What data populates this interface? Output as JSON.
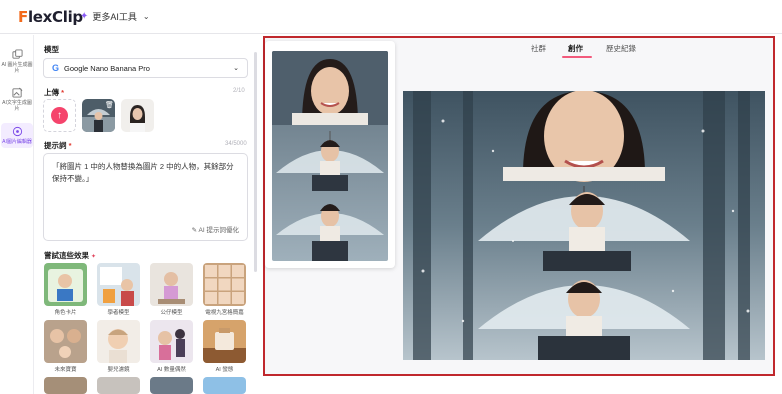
{
  "app": {
    "logo_text_accent": "F",
    "logo_text_rest": "lexClip",
    "more_ai_label": "更多AI工具"
  },
  "rail": {
    "items": [
      {
        "label": "AI 圖片生成圖片"
      },
      {
        "label": "AI文字生成圖片"
      },
      {
        "label": "AI圖片編輯器"
      }
    ]
  },
  "panel": {
    "model_label": "模型",
    "model_value": "Google Nano Banana Pro",
    "upload_label": "上傳",
    "upload_count": "2/10",
    "prompt_label": "提示詞",
    "prompt_count": "34/5000",
    "prompt_text": "「將圖片 1 中的人物替換為圖片 2 中的人物，其餘部分保持不變。」",
    "ai_optimize_label": "AI 提示詞優化",
    "effects_label": "嘗試這些效果",
    "effects": [
      {
        "name": "角色卡片"
      },
      {
        "name": "學者模型"
      },
      {
        "name": "公仔模型"
      },
      {
        "name": "電視九宮格簡嘉"
      },
      {
        "name": "未來寶寶"
      },
      {
        "name": "嬰兒濾鏡"
      },
      {
        "name": "AI 數量偶然"
      },
      {
        "name": "AI 蠻態"
      }
    ]
  },
  "stage": {
    "tabs": [
      {
        "label": "社群"
      },
      {
        "label": "創作"
      },
      {
        "label": "歷史紀錄"
      }
    ],
    "active_tab": "創作"
  },
  "colors": {
    "accent_pink": "#f25a7c",
    "upload_pink": "#f5446c",
    "highlight_border": "#c0282d",
    "active_rail": "#7c4ae8"
  }
}
